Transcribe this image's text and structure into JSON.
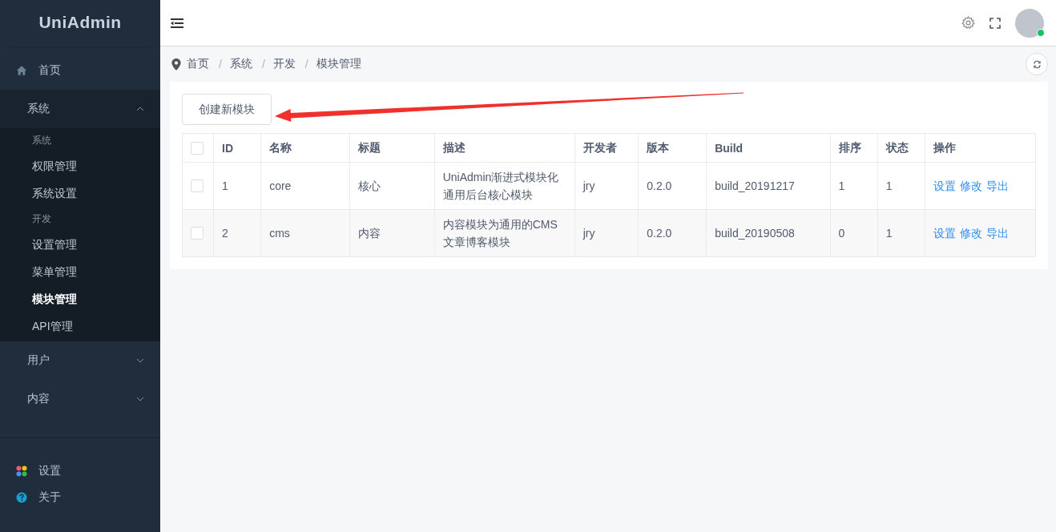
{
  "sidebar": {
    "logo": "UniAdmin",
    "menu": [
      {
        "kind": "link",
        "label": "首页",
        "selected": false
      },
      {
        "kind": "submenu",
        "label": "系统",
        "expanded": true,
        "children": [
          {
            "kind": "group",
            "label": "系统"
          },
          {
            "kind": "item",
            "label": "权限管理",
            "selected": false
          },
          {
            "kind": "item",
            "label": "系统设置",
            "selected": false
          },
          {
            "kind": "group",
            "label": "开发"
          },
          {
            "kind": "item",
            "label": "设置管理",
            "selected": false
          },
          {
            "kind": "item",
            "label": "菜单管理",
            "selected": false
          },
          {
            "kind": "item",
            "label": "模块管理",
            "selected": true
          },
          {
            "kind": "item",
            "label": "API管理",
            "selected": false
          }
        ]
      },
      {
        "kind": "submenu",
        "label": "用户",
        "expanded": false
      },
      {
        "kind": "submenu",
        "label": "内容",
        "expanded": false
      }
    ],
    "footer": [
      {
        "label": "设置"
      },
      {
        "label": "关于"
      }
    ]
  },
  "header": {
    "avatar": {
      "online": true
    }
  },
  "breadcrumb": [
    "首页",
    "系统",
    "开发",
    "模块管理"
  ],
  "breadcrumb_separator": "/",
  "create_button": "创建新模块",
  "table": {
    "header_checked": false,
    "columns": [
      "ID",
      "名称",
      "标题",
      "描述",
      "开发者",
      "版本",
      "Build",
      "排序",
      "状态",
      "操作"
    ],
    "rows": [
      {
        "checked": false,
        "cells": [
          "1",
          "core",
          "核心",
          "UniAdmin渐进式模块化通用后台核心模块",
          "jry",
          "0.2.0",
          "build_20191217",
          "1",
          "1"
        ],
        "actions": [
          "设置",
          "修改",
          "导出"
        ]
      },
      {
        "checked": false,
        "cells": [
          "2",
          "cms",
          "内容",
          "内容模块为通用的CMS文章博客模块",
          "jry",
          "0.2.0",
          "build_20190508",
          "0",
          "1"
        ],
        "actions": [
          "设置",
          "修改",
          "导出"
        ]
      }
    ]
  }
}
